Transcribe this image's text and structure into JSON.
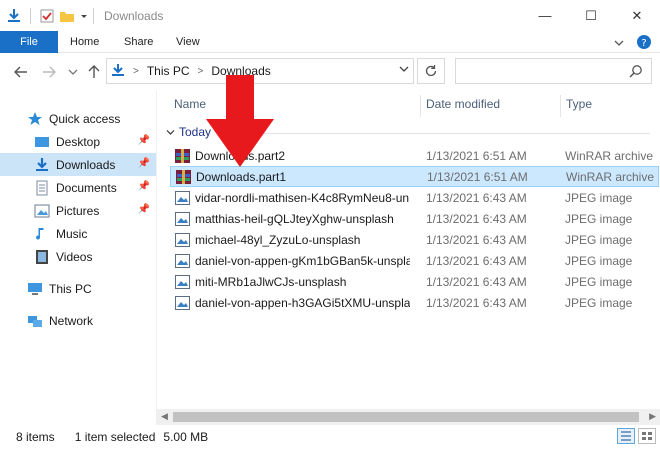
{
  "window": {
    "title": "Downloads",
    "controls": {
      "minimize": "—",
      "maximize": "☐",
      "close": "✕"
    }
  },
  "ribbon": {
    "tabs": [
      {
        "label": "File"
      },
      {
        "label": "Home"
      },
      {
        "label": "Share"
      },
      {
        "label": "View"
      }
    ]
  },
  "nav": {
    "breadcrumb": [
      "This PC",
      "Downloads"
    ],
    "search_placeholder": ""
  },
  "sidebar": {
    "items": [
      {
        "label": "Quick access",
        "icon": "star-icon",
        "pinned": false
      },
      {
        "label": "Desktop",
        "icon": "desktop-icon",
        "pinned": true
      },
      {
        "label": "Downloads",
        "icon": "download-icon",
        "pinned": true,
        "selected": true
      },
      {
        "label": "Documents",
        "icon": "documents-icon",
        "pinned": true
      },
      {
        "label": "Pictures",
        "icon": "pictures-icon",
        "pinned": true
      },
      {
        "label": "Music",
        "icon": "music-icon",
        "pinned": false
      },
      {
        "label": "Videos",
        "icon": "videos-icon",
        "pinned": false
      },
      {
        "label": "This PC",
        "icon": "computer-icon",
        "pinned": false
      },
      {
        "label": "Network",
        "icon": "network-icon",
        "pinned": false
      }
    ]
  },
  "columns": {
    "name": "Name",
    "date": "Date modified",
    "type": "Type"
  },
  "group": {
    "label": "Today (8)",
    "display": "Today"
  },
  "files": [
    {
      "name": "Downloads.part2",
      "date": "1/13/2021 6:51 AM",
      "type": "WinRAR archive",
      "icon": "winrar-icon"
    },
    {
      "name": "Downloads.part1",
      "date": "1/13/2021 6:51 AM",
      "type": "WinRAR archive",
      "icon": "winrar-icon",
      "selected": true
    },
    {
      "name": "vidar-nordli-mathisen-K4c8RymNeu8-un...",
      "date": "1/13/2021 6:43 AM",
      "type": "JPEG image",
      "icon": "jpeg-icon"
    },
    {
      "name": "matthias-heil-gQLJteyXghw-unsplash",
      "date": "1/13/2021 6:43 AM",
      "type": "JPEG image",
      "icon": "jpeg-icon"
    },
    {
      "name": "michael-48yl_ZyzuLo-unsplash",
      "date": "1/13/2021 6:43 AM",
      "type": "JPEG image",
      "icon": "jpeg-icon"
    },
    {
      "name": "daniel-von-appen-gKm1bGBan5k-unspla...",
      "date": "1/13/2021 6:43 AM",
      "type": "JPEG image",
      "icon": "jpeg-icon"
    },
    {
      "name": "miti-MRb1aJlwCJs-unsplash",
      "date": "1/13/2021 6:43 AM",
      "type": "JPEG image",
      "icon": "jpeg-icon"
    },
    {
      "name": "daniel-von-appen-h3GAGi5tXMU-unspla...",
      "date": "1/13/2021 6:43 AM",
      "type": "JPEG image",
      "icon": "jpeg-icon"
    }
  ],
  "status": {
    "item_count": "8 items",
    "selection": "1 item selected",
    "size": "5.00 MB"
  },
  "colors": {
    "accent": "#1a6fc7",
    "selected_row": "#cce8ff",
    "selected_sidebar": "#cce4f7",
    "annotation_arrow": "#e8191d"
  }
}
